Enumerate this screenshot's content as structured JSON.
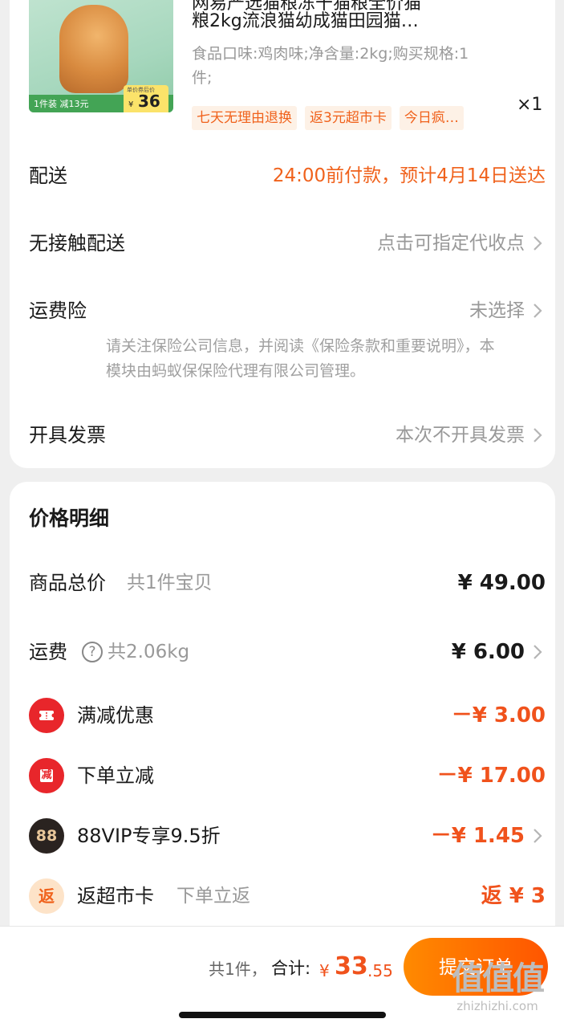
{
  "product": {
    "title_line1": "网易严选猫粮冻干猫粮全价猫",
    "title_line2": "粮2kg流浪猫幼成猫田园猫…",
    "spec": "食品口味:鸡肉味;净含量:2kg;购买规格:1件;",
    "image": {
      "promo_left": "1件装 减13元",
      "caption": "单价券后价",
      "yen": "¥",
      "price": "36"
    },
    "tags": [
      "七天无理由退换",
      "返3元超市卡",
      "今日疯…"
    ],
    "quantity": "×1"
  },
  "order_options": [
    {
      "label": "配送",
      "value": "24:00前付款，预计4月14日送达"
    },
    {
      "label": "无接触配送",
      "value": "点击可指定代收点"
    },
    {
      "label": "运费险",
      "value": "未选择"
    },
    {
      "label": "开具发票",
      "value": "本次不开具发票"
    }
  ],
  "insurance_note": "请关注保险公司信息，并阅读《保险条款和重要说明》，本模块由蚂蚁保保险代理有限公司管理。",
  "price_detail": {
    "title": "价格明细",
    "goods_total": {
      "label": "商品总价",
      "sub": "共1件宝贝",
      "amount": "¥ 49.00"
    },
    "shipping": {
      "label": "运费",
      "help": "?",
      "sub": "共2.06kg",
      "amount": "¥ 6.00"
    },
    "discounts": [
      {
        "label": "满减优惠",
        "sub": "",
        "amount": "－¥ 3.00",
        "icon": "coupon-icon"
      },
      {
        "label": "下单立减",
        "sub": "",
        "amount": "－¥ 17.00",
        "icon": "jian-icon",
        "icon_text": "减"
      },
      {
        "label": "88VIP专享9.5折",
        "sub": "",
        "amount": "－¥ 1.45",
        "icon": "vip88-icon",
        "icon_text": "88"
      },
      {
        "label": "返超市卡",
        "sub": "下单立返",
        "amount": "返 ¥ 3",
        "icon": "fan-icon",
        "icon_text": "返"
      }
    ]
  },
  "bottom_bar": {
    "count": "共1件，",
    "total_label": "合计:",
    "yen": "¥",
    "total_int": "33",
    "total_dec": ".55",
    "submit": "提交订单"
  },
  "watermark": {
    "text": "值值值",
    "url": "zhizhizhi.com"
  },
  "colors": {
    "accent": "#f0621c",
    "discount_red": "#f0521c",
    "button_start": "#ff8a00",
    "button_end": "#ff5500"
  }
}
